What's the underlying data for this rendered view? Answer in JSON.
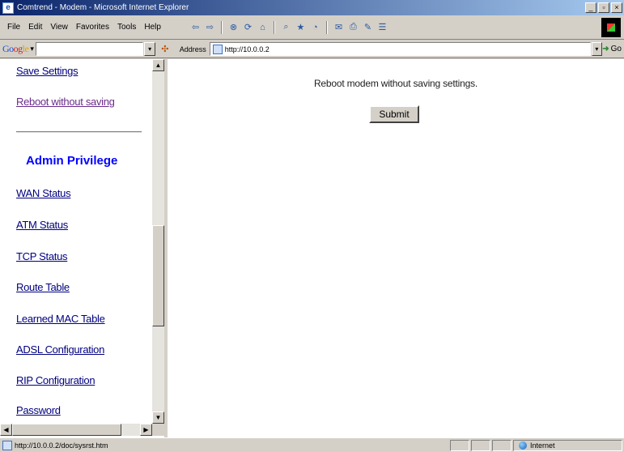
{
  "window": {
    "title": "Comtrend - Modem - Microsoft Internet Explorer",
    "app_icon": "e",
    "minimize": "_",
    "maximize": "▫",
    "close": "×"
  },
  "menubar": {
    "items": [
      "File",
      "Edit",
      "View",
      "Favorites",
      "Tools",
      "Help"
    ]
  },
  "toolbar": {
    "buttons": [
      "back-icon",
      "forward-icon",
      "stop-icon",
      "refresh-icon",
      "home-icon",
      "search-icon",
      "favorites-icon",
      "history-icon",
      "mail-icon",
      "print-icon",
      "edit-icon",
      "discuss-icon"
    ]
  },
  "googlebar": {
    "logo": [
      "Go",
      "og",
      "le"
    ],
    "dropdown": "▾",
    "search_value": ""
  },
  "address": {
    "label": "Address",
    "url": "http://10.0.0.2",
    "go_label": "Go"
  },
  "sidebar": {
    "save_settings": "Save Settings",
    "reboot_without_saving": "Reboot without saving",
    "admin_heading": "Admin Privilege",
    "links": [
      "WAN Status",
      "ATM Status",
      "TCP Status",
      "Route Table",
      "Learned MAC Table",
      "ADSL Configuration",
      "RIP Configuration",
      "Password"
    ]
  },
  "main": {
    "message": "Reboot modem without saving settings.",
    "submit_label": "Submit"
  },
  "statusbar": {
    "url": "http://10.0.0.2/doc/sysrst.htm",
    "zone": "Internet"
  }
}
